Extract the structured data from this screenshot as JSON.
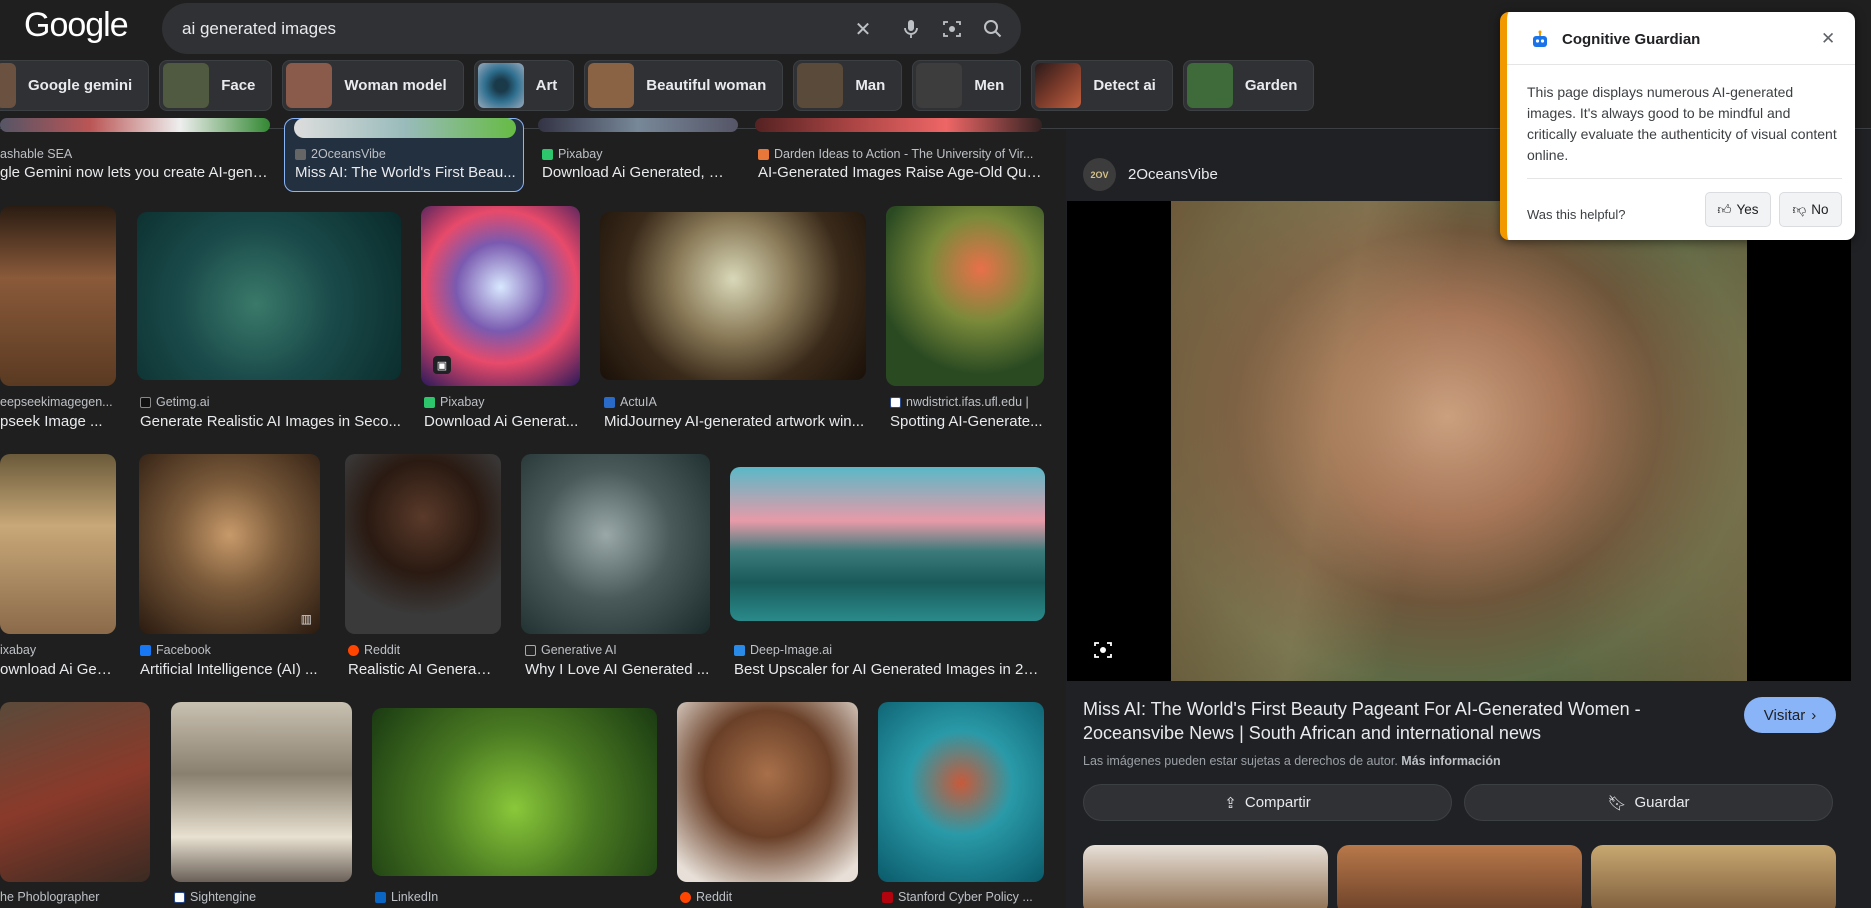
{
  "header": {
    "logo": "Google",
    "search_value": "ai generated images",
    "icons": [
      "close-icon",
      "microphone-icon",
      "lens-icon",
      "search-icon"
    ]
  },
  "chips": [
    {
      "label": "Google gemini",
      "color": "#6b5240"
    },
    {
      "label": "Face",
      "color": "#4f5a40"
    },
    {
      "label": "Woman model",
      "color": "#8a5a4a"
    },
    {
      "label": "Art",
      "color": "#2f6f8f"
    },
    {
      "label": "Beautiful woman",
      "color": "#8a6244"
    },
    {
      "label": "Man",
      "color": "#5a4a3a"
    },
    {
      "label": "Men",
      "color": "#3d3d3d"
    },
    {
      "label": "Detect ai",
      "color": "#7a3a2a"
    },
    {
      "label": "Garden",
      "color": "#3f6a3a"
    }
  ],
  "top_row": [
    {
      "source": "ashable SEA",
      "title": "gle Gemini now lets you create AI-gene..."
    },
    {
      "source": "2OceansVibe",
      "title": "Miss AI: The World's First Beau..."
    },
    {
      "source": "Pixabay",
      "title": "Download Ai Generated, W..."
    },
    {
      "source": "Darden Ideas to Action - The University of Vir...",
      "title": "AI-Generated Images Raise Age-Old Que..."
    }
  ],
  "row1": [
    {
      "source": "eepseekimagegen...",
      "title": "pseek Image ..."
    },
    {
      "source": "Getimg.ai",
      "title": "Generate Realistic AI Images in Seco..."
    },
    {
      "source": "Pixabay",
      "title": "Download Ai Generat..."
    },
    {
      "source": "ActuIA",
      "title": "MidJourney AI-generated artwork win..."
    },
    {
      "source": "nwdistrict.ifas.ufl.edu |",
      "title": "Spotting AI-Generate..."
    }
  ],
  "row2": [
    {
      "source": "ixabay",
      "title": "ownload Ai Gene..."
    },
    {
      "source": "Facebook",
      "title": "Artificial Intelligence (AI) ..."
    },
    {
      "source": "Reddit",
      "title": "Realistic AI Generat..."
    },
    {
      "source": "Generative AI",
      "title": "Why I Love AI Generated ..."
    },
    {
      "source": "Deep-Image.ai",
      "title": "Best Upscaler for AI Generated Images in 20..."
    }
  ],
  "row3": [
    {
      "source": "he Phoblographer"
    },
    {
      "source": "Sightengine"
    },
    {
      "source": "LinkedIn"
    },
    {
      "source": "Reddit"
    },
    {
      "source": "Stanford Cyber Policy ..."
    }
  ],
  "preview": {
    "site": "2OceansVibe",
    "avatar_text": "2OV",
    "title": "Miss AI: The World's First Beauty Pageant For AI-Generated Women - 2oceansvibe News | South African and international news",
    "visit_label": "Visitar",
    "copyright_text": "Las imágenes pueden estar sujetas a derechos de autor.",
    "more_info": "Más información",
    "share_label": "Compartir",
    "save_label": "Guardar"
  },
  "extension": {
    "title": "Cognitive Guardian",
    "message": "This page displays numerous AI-generated images. It's always good to be mindful and critically evaluate the authenticity of visual content online.",
    "question": "Was this helpful?",
    "yes_label": "Yes",
    "no_label": "No",
    "accent_color": "#f29900"
  }
}
